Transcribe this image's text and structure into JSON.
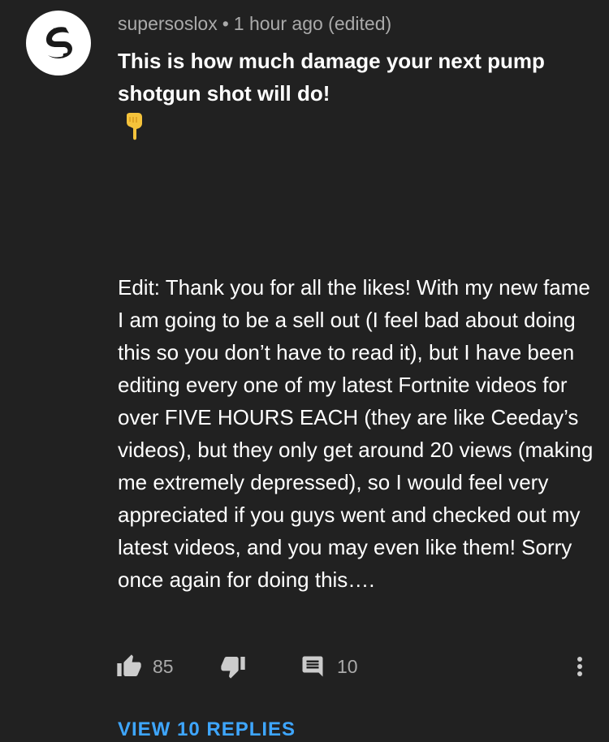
{
  "comment": {
    "author": "supersoslox",
    "separator": "•",
    "time": "1 hour ago (edited)",
    "headline": "This is how much damage your next pump shotgun shot will do!",
    "emoji_icon": "pointing-down-hand-icon",
    "body": "Edit: Thank you for all the likes! With my new fame I am going to be a sell out (I feel bad about doing this so you don’t have to read it), but I have been editing every one of my latest Fortnite videos for over FIVE HOURS EACH (they are like Ceeday’s videos), but they only get around 20 views (making me extremely depressed), so I would feel very appreciated if you guys went and checked out my latest videos, and you may even like them! Sorry once again for doing this…."
  },
  "actions": {
    "like_count": "85",
    "reply_count": "10"
  },
  "replies": {
    "label": "VIEW 10 REPLIES"
  },
  "colors": {
    "background": "#212121",
    "text": "#ffffff",
    "secondary_text": "#aaaaaa",
    "link": "#3ea6ff",
    "emoji": "#f5c33b"
  }
}
